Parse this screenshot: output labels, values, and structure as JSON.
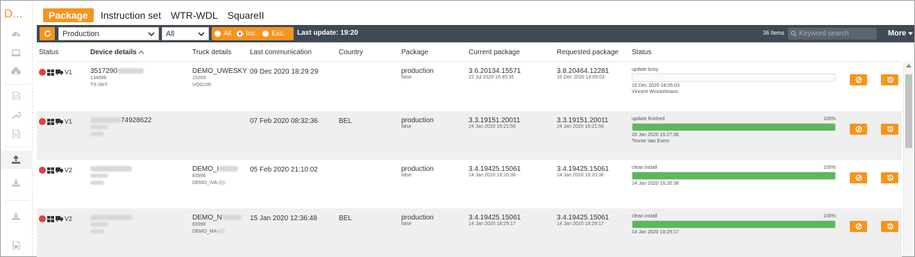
{
  "app": {
    "logo_text": "D..."
  },
  "sidebar": {
    "items": [
      {
        "icon": "dashboard-icon"
      },
      {
        "icon": "laptop-icon"
      },
      {
        "icon": "cloud-download-icon"
      },
      {
        "icon": "document-icon"
      },
      {
        "icon": "wrench-icon"
      },
      {
        "icon": "document-icon"
      },
      {
        "icon": "upload-icon"
      },
      {
        "icon": "download-icon"
      },
      {
        "icon": "download-icon"
      },
      {
        "icon": "file-icon"
      }
    ],
    "active_index": 6
  },
  "tabs": [
    {
      "label": "Package",
      "active": true
    },
    {
      "label": "Instruction set",
      "active": false
    },
    {
      "label": "WTR-WDL",
      "active": false
    },
    {
      "label": "SquareII",
      "active": false
    }
  ],
  "toolbar": {
    "environment_select": "Production",
    "filter_select": "All",
    "radios": [
      {
        "label": "All",
        "checked": false
      },
      {
        "label": "Inc.",
        "checked": true
      },
      {
        "label": "Exc.",
        "checked": false
      }
    ],
    "last_update": "Last update: 19:20",
    "items_count": "36 Items",
    "search_placeholder": "Keyword search",
    "more_label": "More"
  },
  "table": {
    "headers": {
      "status": "Status",
      "device_details": "Device details",
      "truck_details": "Truck details",
      "last_communication": "Last communication",
      "country": "Country",
      "package": "Package",
      "current_package": "Current package",
      "requested_package": "Requested package",
      "update_status": "Status"
    },
    "rows": [
      {
        "version": "V1",
        "device_id": "3517290",
        "device_sub1": "134686",
        "device_sub2": "TX-SKY",
        "truck": "DEMO_UWESKY",
        "truck_sub1": "15200",
        "truck_sub2": "VOGUW",
        "last_comm": "09 Dec 2020 18:29:29",
        "country": "",
        "package": "production",
        "package_sub": "false",
        "current": "3.6.20134.15571",
        "current_date": "22 Jul 2020 16:45:35",
        "requested": "3.8.20464.12281",
        "requested_date": "16 Dec 2020 18:05:03",
        "status_label": "update busy",
        "progress": 0,
        "progress_text": "",
        "status_time": "16 Dec 2020 18:05:03",
        "status_user": "Vincent Winckelmans"
      },
      {
        "version": "V1",
        "device_id": "74928622",
        "device_sub1": "",
        "device_sub2": "",
        "truck": "",
        "truck_sub1": "",
        "truck_sub2": "",
        "last_comm": "07 Feb 2020 08:32:36",
        "country": "BEL",
        "package": "production",
        "package_sub": "false",
        "current": "3.3.19151.20011",
        "current_date": "24 Jan 2020 16:21:56",
        "requested": "3.3.19151.20011",
        "requested_date": "24 Jan 2020 16:21:56",
        "status_label": "update finished",
        "progress": 100,
        "progress_text": "100%",
        "status_time": "28 Jan 2020 15:27:36",
        "status_user": "Tonnie Van Exem"
      },
      {
        "version": "V2",
        "device_id": "",
        "device_sub1": "",
        "device_sub2": "",
        "truck": "DEMO_I",
        "truck_sub1": "83996",
        "truck_sub2": "DEMO_IVA",
        "last_comm": "05 Feb 2020 21:10:02",
        "country": "",
        "package": "production",
        "package_sub": "false",
        "current": "3.4.19425.15061",
        "current_date": "14 Jan 2020 16:20:38",
        "requested": "3.4.19425.15061",
        "requested_date": "14 Jan 2020 16:20:38",
        "status_label": "clean install",
        "progress": 100,
        "progress_text": "100%",
        "status_time": "14 Jan 2020 16:20:38",
        "status_user": ""
      },
      {
        "version": "V2",
        "device_id": "",
        "device_sub1": "",
        "device_sub2": "",
        "truck": "DEMO_N",
        "truck_sub1": "83996",
        "truck_sub2": "DEMO_MA",
        "last_comm": "15 Jan 2020 12:36:48",
        "country": "BEL",
        "package": "production",
        "package_sub": "false",
        "current": "3.4.19425.15061",
        "current_date": "14 Jan 2020 18:29:17",
        "requested": "3.4.19425.15061",
        "requested_date": "14 Jan 2020 18:29:17",
        "status_label": "clean install",
        "progress": 100,
        "progress_text": "100%",
        "status_time": "14 Jan 2020 18:29:17",
        "status_user": ""
      }
    ]
  },
  "colors": {
    "accent": "#f7941d",
    "toolbar": "#3f4a55",
    "status_offline": "#e3413c",
    "progress": "#5cb85c"
  }
}
